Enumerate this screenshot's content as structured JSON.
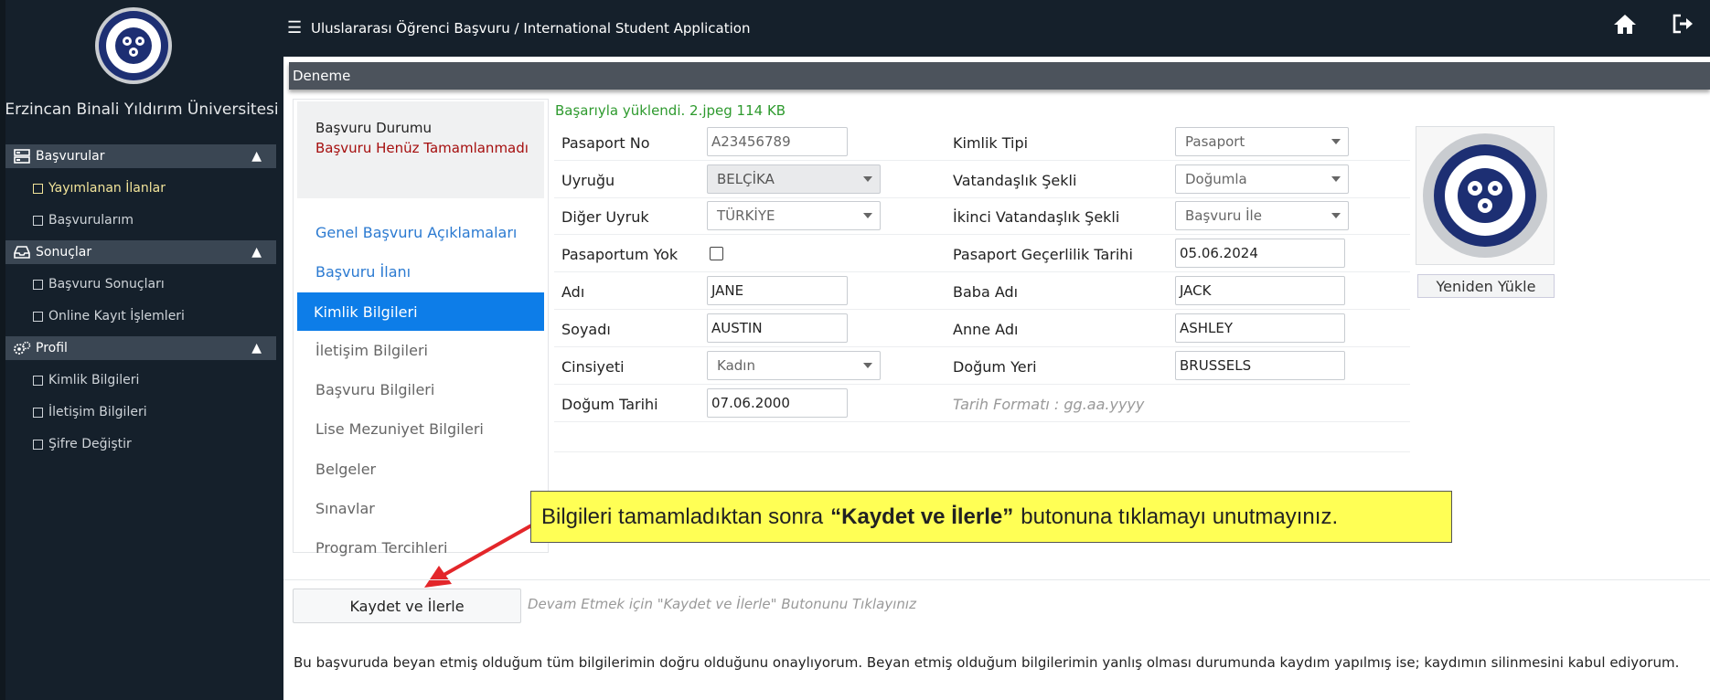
{
  "sidebar": {
    "brand": "Erzincan Binali Yıldırım Üniversitesi",
    "sections": [
      {
        "label": "Başvurular",
        "icon": "server-icon"
      },
      {
        "label": "Sonuçlar",
        "icon": "inbox-icon"
      },
      {
        "label": "Profil",
        "icon": "gears-icon"
      }
    ],
    "items": {
      "yayimlanan": "Yayımlanan İlanlar",
      "basvurularim": "Başvurularım",
      "basvuru_sonuclari": "Başvuru Sonuçları",
      "online_kayit": "Online Kayıt İşlemleri",
      "kimlik": "Kimlik Bilgileri",
      "iletisim": "İletişim Bilgileri",
      "sifre": "Şifre Değiştir"
    }
  },
  "topbar": {
    "title": "Uluslararası Öğrenci Başvuru / International Student Application"
  },
  "subbar": {
    "title": "Deneme"
  },
  "status": {
    "label": "Başvuru Durumu",
    "value": "Başvuru Henüz Tamamlanmadı",
    "value_color": "#a50e0e"
  },
  "nav": {
    "genel": "Genel Başvuru Açıklamaları",
    "ilan": "Başvuru İlanı",
    "kimlik": "Kimlik Bilgileri",
    "iletisim": "İletişim Bilgileri",
    "basvuru": "Başvuru Bilgileri",
    "lise": "Lise Mezuniyet Bilgileri",
    "belgeler": "Belgeler",
    "sinavlar": "Sınavlar",
    "program": "Program Tercihleri"
  },
  "form": {
    "success_message": "Başarıyla yüklendi. 2.jpeg 114 KB",
    "pasaport_no": {
      "label": "Pasaport No",
      "value": "A23456789"
    },
    "kimlik_tipi": {
      "label": "Kimlik Tipi",
      "value": "Pasaport"
    },
    "uyrugu": {
      "label": "Uyruğu",
      "value": "BELÇİKA"
    },
    "vatandaslik_sekli": {
      "label": "Vatandaşlık Şekli",
      "value": "Doğumla"
    },
    "diger_uyruk": {
      "label": "Diğer Uyruk",
      "value": "TÜRKİYE"
    },
    "ikinci_vatandaslik": {
      "label": "İkinci Vatandaşlık Şekli",
      "value": "Başvuru İle"
    },
    "pasaportum_yok": {
      "label": "Pasaportum Yok"
    },
    "pasaport_gecerlilik": {
      "label": "Pasaport Geçerlilik Tarihi",
      "value": "05.06.2024"
    },
    "adi": {
      "label": "Adı",
      "value": "JANE"
    },
    "baba_adi": {
      "label": "Baba Adı",
      "value": "JACK"
    },
    "soyadi": {
      "label": "Soyadı",
      "value": "AUSTIN"
    },
    "anne_adi": {
      "label": "Anne Adı",
      "value": "ASHLEY"
    },
    "cinsiyeti": {
      "label": "Cinsiyeti",
      "value": "Kadın"
    },
    "dogum_yeri": {
      "label": "Doğum Yeri",
      "value": "BRUSSELS"
    },
    "dogum_tarihi": {
      "label": "Doğum Tarihi",
      "value": "07.06.2000"
    },
    "date_hint": "Tarih Formatı : gg.aa.yyyy",
    "reupload": "Yeniden Yükle"
  },
  "callout": {
    "before": "Bilgileri tamamladıktan sonra",
    "bold": "“Kaydet ve İlerle”",
    "after": "butonuna tıklamayı unutmayınız."
  },
  "actions": {
    "save": "Kaydet ve İlerle",
    "continue_hint": "Devam Etmek için \"Kaydet ve İlerle\" Butonunu Tıklayınız"
  },
  "declaration": "Bu başvuruda beyan etmiş olduğum tüm bilgilerimin doğru olduğunu onaylıyorum. Beyan etmiş olduğum bilgilerimin yanlış olması durumunda kaydım yapılmış ise; kaydımın silinmesini kabul ediyorum.",
  "colors": {
    "sidebar_bg": "#15202b",
    "active_nav": "#0d7de8",
    "success": "#2e9a2e",
    "callout_bg": "#ffff55",
    "arrow": "#e3262a"
  }
}
